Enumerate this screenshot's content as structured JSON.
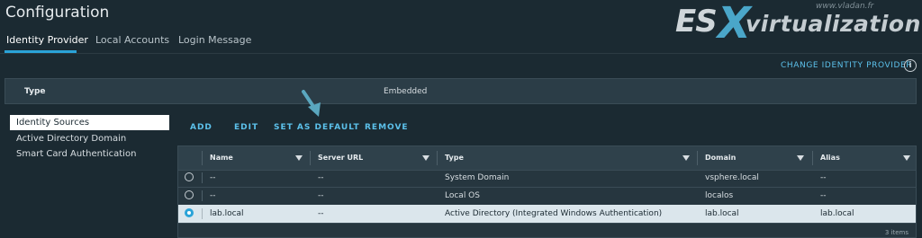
{
  "page": {
    "title": "Configuration"
  },
  "tabs": [
    {
      "label": "Identity Provider",
      "active": true
    },
    {
      "label": "Local Accounts",
      "active": false
    },
    {
      "label": "Login Message",
      "active": false
    }
  ],
  "watermark": {
    "site": "www.vladan.fr",
    "logo_es": "ES",
    "logo_x": "X",
    "logo_rest": "virtualization"
  },
  "header_action": {
    "change_idp_label": "CHANGE IDENTITY PROVIDER",
    "info_glyph": "i"
  },
  "type_bar": {
    "label": "Type",
    "value": "Embedded"
  },
  "sidebar": {
    "items": [
      {
        "label": "Identity Sources",
        "active": true
      },
      {
        "label": "Active Directory Domain",
        "active": false
      },
      {
        "label": "Smart Card Authentication",
        "active": false
      }
    ]
  },
  "toolbar": {
    "add": "ADD",
    "edit": "EDIT",
    "set_default": "SET AS DEFAULT",
    "remove": "REMOVE"
  },
  "table": {
    "columns": [
      "Name",
      "Server URL",
      "Type",
      "Domain",
      "Alias"
    ],
    "rows": [
      {
        "name": "--",
        "server_url": "--",
        "type": "System Domain",
        "domain": "vsphere.local",
        "alias": "--",
        "selected": false
      },
      {
        "name": "--",
        "server_url": "--",
        "type": "Local OS",
        "domain": "localos",
        "alias": "--",
        "selected": false
      },
      {
        "name": "lab.local",
        "server_url": "--",
        "type": "Active Directory (Integrated Windows Authentication)",
        "domain": "lab.local",
        "alias": "lab.local",
        "selected": true
      }
    ],
    "footer": "3 items"
  },
  "colors": {
    "accent": "#2aa3d8",
    "link": "#5cc1eb",
    "background": "#1b2a32",
    "annotation_arrow": "#5aa7bf"
  },
  "icons": [
    "info-icon",
    "filter-icon",
    "radio-icon",
    "arrow-annotation-icon"
  ]
}
